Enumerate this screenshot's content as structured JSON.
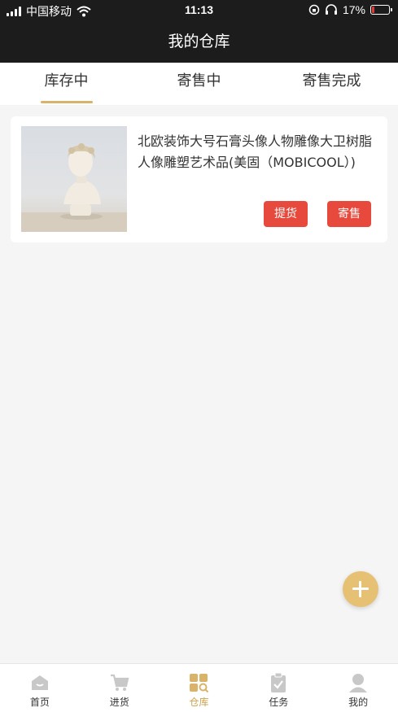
{
  "status_bar": {
    "carrier": "中国移动",
    "time": "11:13",
    "battery": "17%",
    "battery_level": 0.17,
    "icons": [
      "signal-icon",
      "wifi-icon",
      "rotation-lock-icon",
      "headphones-icon",
      "battery-icon"
    ]
  },
  "header": {
    "title": "我的仓库"
  },
  "tabs": [
    {
      "label": "库存中",
      "active": true
    },
    {
      "label": "寄售中",
      "active": false
    },
    {
      "label": "寄售完成",
      "active": false
    }
  ],
  "items": [
    {
      "title": "北欧装饰大号石膏头像人物雕像大卫树脂人像雕塑艺术品(美固（MOBICOOL）)",
      "pickup_label": "提货",
      "consign_label": "寄售"
    }
  ],
  "fab": {
    "icon": "plus-icon"
  },
  "bottom_nav": [
    {
      "label": "首页",
      "icon": "home-icon",
      "active": false
    },
    {
      "label": "进货",
      "icon": "cart-icon",
      "active": false
    },
    {
      "label": "仓库",
      "icon": "warehouse-icon",
      "active": true
    },
    {
      "label": "任务",
      "icon": "clipboard-icon",
      "active": false
    },
    {
      "label": "我的",
      "icon": "user-icon",
      "active": false
    }
  ],
  "colors": {
    "header_bg": "#1c1c1c",
    "accent_gold": "#d9b36a",
    "button_red": "#e74a3c",
    "nav_active": "#c9a34f",
    "nav_inactive": "#c8c8c8"
  }
}
